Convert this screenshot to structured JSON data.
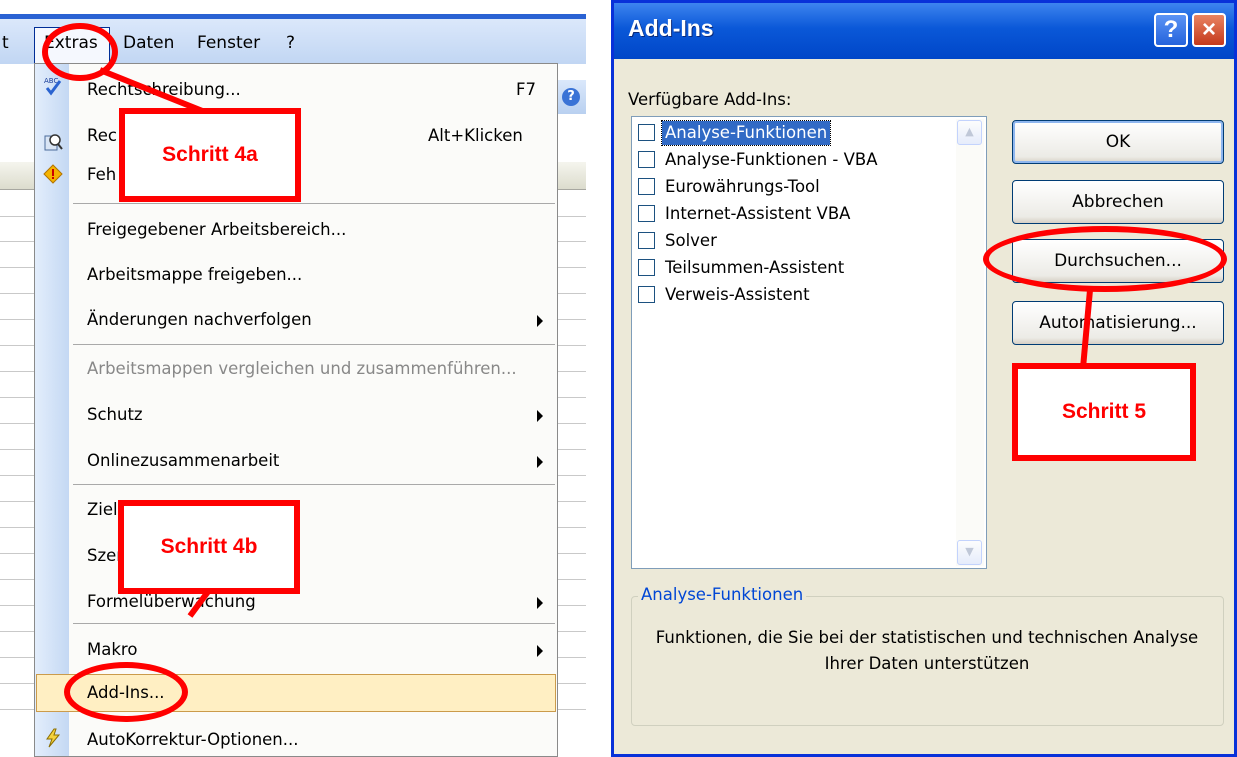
{
  "excel": {
    "menubar": {
      "items": [
        {
          "label": "t"
        },
        {
          "label": "Extras"
        },
        {
          "label": "Daten"
        },
        {
          "label": "Fenster"
        },
        {
          "label": "?"
        }
      ]
    },
    "menu": {
      "items": [
        {
          "label": "Rechtschreibung...",
          "shortcut": "F7"
        },
        {
          "label": "Rec",
          "shortcut": "Alt+Klicken"
        },
        {
          "label": "Feh"
        },
        {
          "label": "Freigegebener Arbeitsbereich..."
        },
        {
          "label": "Arbeitsmappe freigeben..."
        },
        {
          "label": "Änderungen nachverfolgen"
        },
        {
          "label": "Arbeitsmappen vergleichen und zusammenführen..."
        },
        {
          "label": "Schutz"
        },
        {
          "label": "Onlinezusammenarbeit"
        },
        {
          "label": "Ziel"
        },
        {
          "label": "Szen"
        },
        {
          "label": "Formelüberwachung"
        },
        {
          "label": "Makro"
        },
        {
          "label": "Add-Ins..."
        },
        {
          "label": "AutoKorrektur-Optionen..."
        }
      ]
    }
  },
  "dialog": {
    "title": "Add-Ins",
    "help_glyph": "?",
    "close_glyph": "×",
    "available_label": "Verfügbare Add-Ins:",
    "addins": [
      {
        "label": "Analyse-Funktionen",
        "checked": false,
        "selected": true
      },
      {
        "label": "Analyse-Funktionen - VBA",
        "checked": false
      },
      {
        "label": "Eurowährungs-Tool",
        "checked": false
      },
      {
        "label": "Internet-Assistent VBA",
        "checked": false
      },
      {
        "label": "Solver",
        "checked": false
      },
      {
        "label": "Teilsummen-Assistent",
        "checked": false
      },
      {
        "label": "Verweis-Assistent",
        "checked": false
      }
    ],
    "buttons": {
      "ok": "OK",
      "cancel": "Abbrechen",
      "browse": "Durchsuchen...",
      "automation": "Automatisierung..."
    },
    "description": {
      "title": "Analyse-Funktionen",
      "text": "Funktionen, die Sie bei der statistischen und technischen Analyse Ihrer Daten unterstützen"
    }
  },
  "annotations": {
    "step4a": "Schritt 4a",
    "step4b": "Schritt 4b",
    "step5": "Schritt 5",
    "color": "#ff0000"
  }
}
